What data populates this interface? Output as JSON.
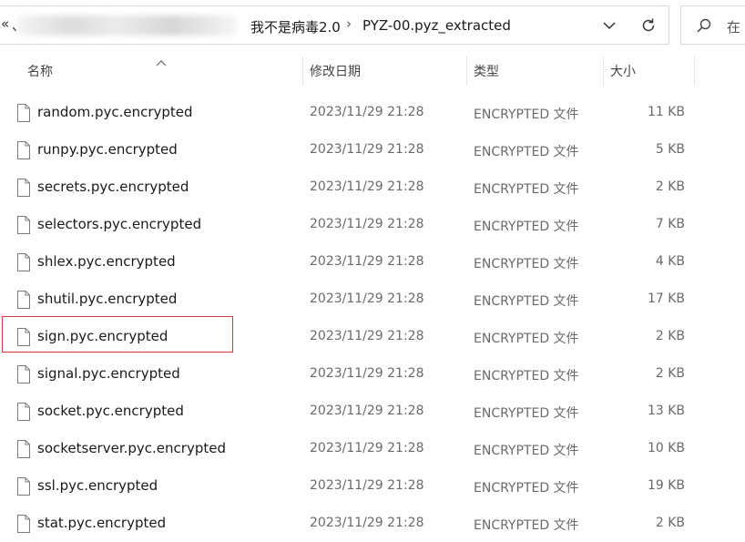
{
  "address_bar": {
    "overflow_glyph": "«",
    "path_prefix_glyph": "、",
    "crumbs": [
      "我不是病毒2.0",
      "PYZ-00.pyz_extracted"
    ],
    "separator": "›"
  },
  "search": {
    "placeholder": "在"
  },
  "columns": {
    "name": "名称",
    "date": "修改日期",
    "type": "类型",
    "size": "大小",
    "sort_column": "name",
    "sort_direction": "ascending"
  },
  "files": [
    {
      "name": "random.pyc.encrypted",
      "date": "2023/11/29 21:28",
      "type": "ENCRYPTED 文件",
      "size": "11 KB"
    },
    {
      "name": "runpy.pyc.encrypted",
      "date": "2023/11/29 21:28",
      "type": "ENCRYPTED 文件",
      "size": "5 KB"
    },
    {
      "name": "secrets.pyc.encrypted",
      "date": "2023/11/29 21:28",
      "type": "ENCRYPTED 文件",
      "size": "2 KB"
    },
    {
      "name": "selectors.pyc.encrypted",
      "date": "2023/11/29 21:28",
      "type": "ENCRYPTED 文件",
      "size": "7 KB"
    },
    {
      "name": "shlex.pyc.encrypted",
      "date": "2023/11/29 21:28",
      "type": "ENCRYPTED 文件",
      "size": "4 KB"
    },
    {
      "name": "shutil.pyc.encrypted",
      "date": "2023/11/29 21:28",
      "type": "ENCRYPTED 文件",
      "size": "17 KB"
    },
    {
      "name": "sign.pyc.encrypted",
      "date": "2023/11/29 21:28",
      "type": "ENCRYPTED 文件",
      "size": "2 KB",
      "highlighted": true
    },
    {
      "name": "signal.pyc.encrypted",
      "date": "2023/11/29 21:28",
      "type": "ENCRYPTED 文件",
      "size": "2 KB"
    },
    {
      "name": "socket.pyc.encrypted",
      "date": "2023/11/29 21:28",
      "type": "ENCRYPTED 文件",
      "size": "13 KB"
    },
    {
      "name": "socketserver.pyc.encrypted",
      "date": "2023/11/29 21:28",
      "type": "ENCRYPTED 文件",
      "size": "10 KB"
    },
    {
      "name": "ssl.pyc.encrypted",
      "date": "2023/11/29 21:28",
      "type": "ENCRYPTED 文件",
      "size": "19 KB"
    },
    {
      "name": "stat.pyc.encrypted",
      "date": "2023/11/29 21:28",
      "type": "ENCRYPTED 文件",
      "size": "2 KB"
    }
  ],
  "colors": {
    "highlight_border": "#d23a3a",
    "secondary_text": "#6a6a6a"
  },
  "icons": [
    "chevron-down-icon",
    "refresh-icon",
    "search-icon",
    "file-icon",
    "sort-up-icon"
  ]
}
